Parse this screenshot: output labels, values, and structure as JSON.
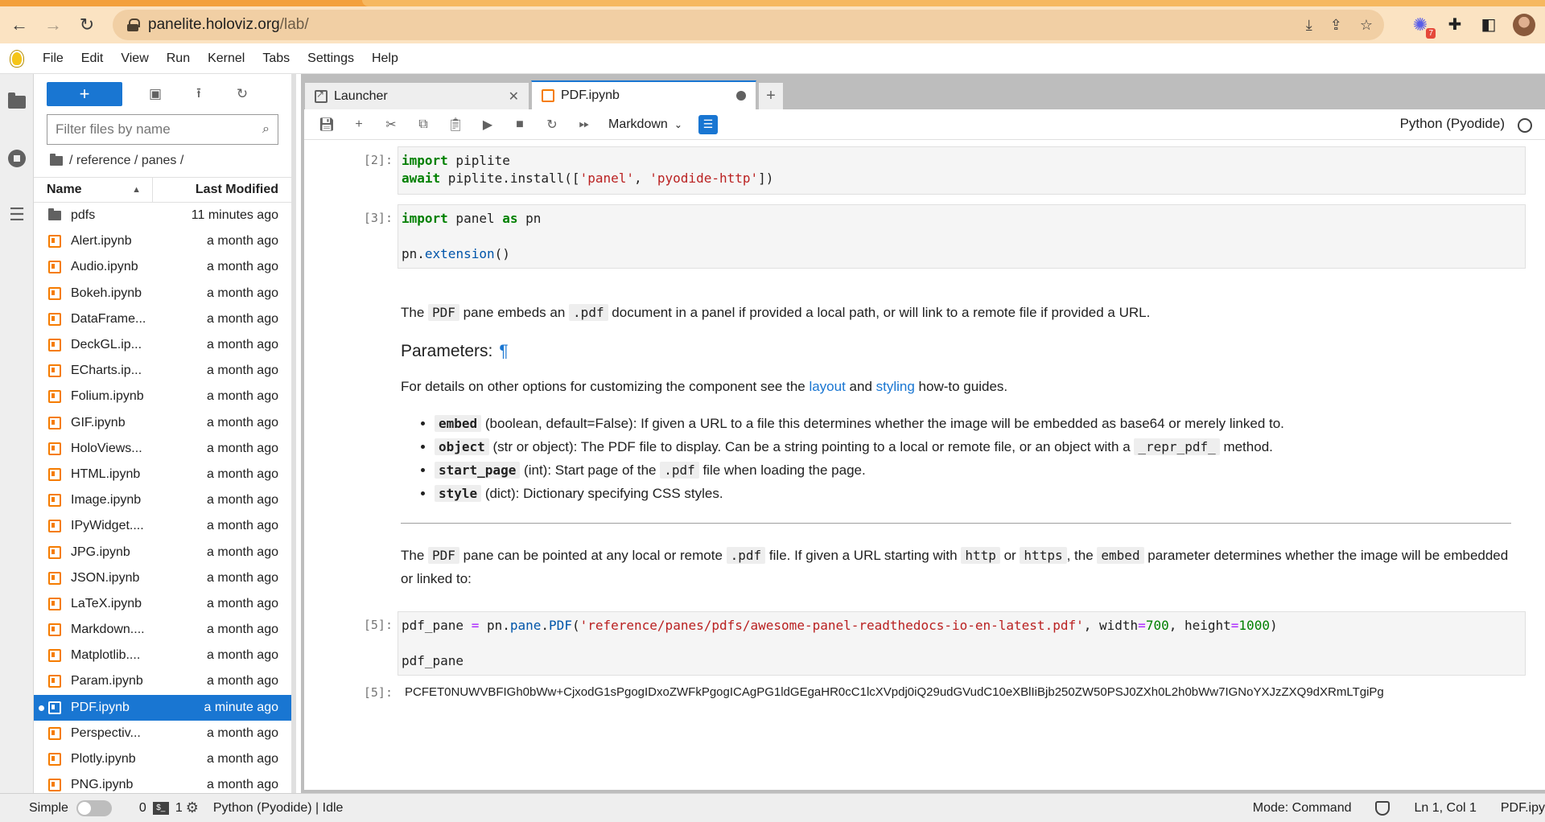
{
  "browser": {
    "url_host": "panelite.holoviz.org",
    "url_path": "/lab/",
    "extension_badge": "7"
  },
  "menubar": [
    "File",
    "Edit",
    "View",
    "Run",
    "Kernel",
    "Tabs",
    "Settings",
    "Help"
  ],
  "filebrowser": {
    "new_label": "+",
    "filter_placeholder": "Filter files by name",
    "breadcrumb": "/ reference / panes /",
    "col_name": "Name",
    "col_modified": "Last Modified",
    "files": [
      {
        "name": "pdfs",
        "modified": "11 minutes ago",
        "type": "dir"
      },
      {
        "name": "Alert.ipynb",
        "modified": "a month ago",
        "type": "nb"
      },
      {
        "name": "Audio.ipynb",
        "modified": "a month ago",
        "type": "nb"
      },
      {
        "name": "Bokeh.ipynb",
        "modified": "a month ago",
        "type": "nb"
      },
      {
        "name": "DataFrame...",
        "modified": "a month ago",
        "type": "nb"
      },
      {
        "name": "DeckGL.ip...",
        "modified": "a month ago",
        "type": "nb"
      },
      {
        "name": "ECharts.ip...",
        "modified": "a month ago",
        "type": "nb"
      },
      {
        "name": "Folium.ipynb",
        "modified": "a month ago",
        "type": "nb"
      },
      {
        "name": "GIF.ipynb",
        "modified": "a month ago",
        "type": "nb"
      },
      {
        "name": "HoloViews...",
        "modified": "a month ago",
        "type": "nb"
      },
      {
        "name": "HTML.ipynb",
        "modified": "a month ago",
        "type": "nb"
      },
      {
        "name": "Image.ipynb",
        "modified": "a month ago",
        "type": "nb"
      },
      {
        "name": "IPyWidget....",
        "modified": "a month ago",
        "type": "nb"
      },
      {
        "name": "JPG.ipynb",
        "modified": "a month ago",
        "type": "nb"
      },
      {
        "name": "JSON.ipynb",
        "modified": "a month ago",
        "type": "nb"
      },
      {
        "name": "LaTeX.ipynb",
        "modified": "a month ago",
        "type": "nb"
      },
      {
        "name": "Markdown....",
        "modified": "a month ago",
        "type": "nb"
      },
      {
        "name": "Matplotlib....",
        "modified": "a month ago",
        "type": "nb"
      },
      {
        "name": "Param.ipynb",
        "modified": "a month ago",
        "type": "nb"
      },
      {
        "name": "PDF.ipynb",
        "modified": "a minute ago",
        "type": "nb",
        "selected": true
      },
      {
        "name": "Perspectiv...",
        "modified": "a month ago",
        "type": "nb"
      },
      {
        "name": "Plotly.ipynb",
        "modified": "a month ago",
        "type": "nb"
      },
      {
        "name": "PNG.ipynb",
        "modified": "a month ago",
        "type": "nb"
      }
    ]
  },
  "tabs": {
    "launcher": "Launcher",
    "notebook": "PDF.ipynb",
    "add": "+"
  },
  "toolbar": {
    "cell_type": "Markdown",
    "kernel": "Python (Pyodide)"
  },
  "cells": {
    "c2_prompt": "[2]:",
    "c3_prompt": "[3]:",
    "c5_prompt": "[5]:",
    "out5_prompt": "[5]:",
    "output_text": "PCFET0NUWVBFIGh0bWw+CjxodG1sPgogIDxoZWFkPgogICAgPG1ldGEgaHR0cC1lcXVpdj0iQ29udGVudC10eXBlIiBjb250ZW50PSJ0ZXh0L2h0bWw7IGNoYXJzZXQ9dXRmLTgiPg"
  },
  "markdown": {
    "intro_1": "The ",
    "intro_code_pdf": "PDF",
    "intro_2": " pane embeds an ",
    "intro_code_ext": ".pdf",
    "intro_3": " document in a panel if provided a local path, or will link to a remote file if provided a URL.",
    "params_heading": "Parameters:",
    "params_anchor": "¶",
    "details_1": "For details on other options for customizing the component see the ",
    "details_link1": "layout",
    "details_2": " and ",
    "details_link2": "styling",
    "details_3": " how-to guides.",
    "params": [
      {
        "name": "embed",
        "desc": " (boolean, default=False): If given a URL to a file this determines whether the image will be embedded as base64 or merely linked to."
      },
      {
        "name": "object",
        "desc": " (str or object): The PDF file to display. Can be a string pointing to a local or remote file, or an object with a ",
        "code": "_repr_pdf_",
        "desc2": " method."
      },
      {
        "name": "start_page",
        "desc": " (int): Start page of the ",
        "code": ".pdf",
        "desc2": " file when loading the page."
      },
      {
        "name": "style",
        "desc": " (dict): Dictionary specifying CSS styles."
      }
    ],
    "para2_1": "The ",
    "para2_code1": "PDF",
    "para2_2": " pane can be pointed at any local or remote ",
    "para2_code2": ".pdf",
    "para2_3": " file. If given a URL starting with ",
    "para2_code3": "http",
    "para2_4": " or ",
    "para2_code4": "https",
    "para2_5": ", the ",
    "para2_code5": "embed",
    "para2_6": " parameter determines whether the image will be embedded or linked to:"
  },
  "statusbar": {
    "mode_simple": "Simple",
    "count": "0",
    "terminal_count": "1",
    "kernel_status": "Python (Pyodide) | Idle",
    "mode": "Mode: Command",
    "position": "Ln 1, Col 1",
    "file": "PDF.ipy"
  }
}
